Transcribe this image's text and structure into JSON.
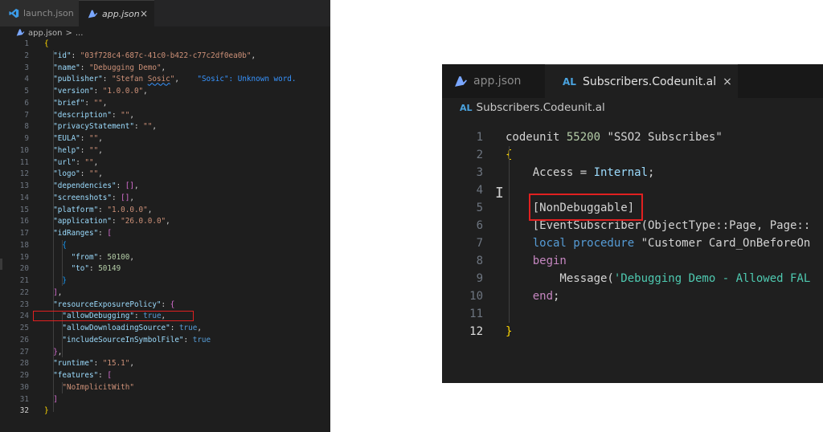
{
  "left_editor": {
    "tabs": [
      {
        "label": "launch.json",
        "icon": "vscode-icon",
        "active": false
      },
      {
        "label": "app.json",
        "icon": "al-file-icon",
        "active": true
      }
    ],
    "close_glyph": "×",
    "breadcrumb": {
      "file": "app.json",
      "separator": ">",
      "rest": "..."
    },
    "line_numbers": [
      "1",
      "2",
      "3",
      "4",
      "5",
      "6",
      "7",
      "8",
      "9",
      "10",
      "11",
      "12",
      "13",
      "14",
      "15",
      "16",
      "17",
      "18",
      "19",
      "20",
      "21",
      "22",
      "23",
      "24",
      "25",
      "26",
      "27",
      "28",
      "29",
      "30",
      "31",
      "32"
    ],
    "active_line": "32",
    "lines": [
      [
        {
          "t": "{",
          "c": "br1"
        }
      ],
      [
        {
          "t": "  \"id\"",
          "c": "key"
        },
        {
          "t": ": ",
          "c": "pun"
        },
        {
          "t": "\"03f728c4-687c-41c0-b422-c77c2df0ea0b\"",
          "c": "str"
        },
        {
          "t": ",",
          "c": "pun"
        }
      ],
      [
        {
          "t": "  \"name\"",
          "c": "key"
        },
        {
          "t": ": ",
          "c": "pun"
        },
        {
          "t": "\"Debugging Demo\"",
          "c": "str"
        },
        {
          "t": ",",
          "c": "pun"
        }
      ],
      [
        {
          "t": "  \"publisher\"",
          "c": "key"
        },
        {
          "t": ": ",
          "c": "pun"
        },
        {
          "t": "\"Stefan ",
          "c": "str"
        },
        {
          "t": "Sosic",
          "c": "str squig"
        },
        {
          "t": "\"",
          "c": "str"
        },
        {
          "t": ",",
          "c": "pun"
        },
        {
          "t": "    \"Sosic\": Unknown word.",
          "c": "warn"
        }
      ],
      [
        {
          "t": "  \"version\"",
          "c": "key"
        },
        {
          "t": ": ",
          "c": "pun"
        },
        {
          "t": "\"1.0.0.0\"",
          "c": "str"
        },
        {
          "t": ",",
          "c": "pun"
        }
      ],
      [
        {
          "t": "  \"brief\"",
          "c": "key"
        },
        {
          "t": ": ",
          "c": "pun"
        },
        {
          "t": "\"\"",
          "c": "str"
        },
        {
          "t": ",",
          "c": "pun"
        }
      ],
      [
        {
          "t": "  \"description\"",
          "c": "key"
        },
        {
          "t": ": ",
          "c": "pun"
        },
        {
          "t": "\"\"",
          "c": "str"
        },
        {
          "t": ",",
          "c": "pun"
        }
      ],
      [
        {
          "t": "  \"privacyStatement\"",
          "c": "key"
        },
        {
          "t": ": ",
          "c": "pun"
        },
        {
          "t": "\"\"",
          "c": "str"
        },
        {
          "t": ",",
          "c": "pun"
        }
      ],
      [
        {
          "t": "  \"EULA\"",
          "c": "key"
        },
        {
          "t": ": ",
          "c": "pun"
        },
        {
          "t": "\"\"",
          "c": "str"
        },
        {
          "t": ",",
          "c": "pun"
        }
      ],
      [
        {
          "t": "  \"help\"",
          "c": "key"
        },
        {
          "t": ": ",
          "c": "pun"
        },
        {
          "t": "\"\"",
          "c": "str"
        },
        {
          "t": ",",
          "c": "pun"
        }
      ],
      [
        {
          "t": "  \"url\"",
          "c": "key"
        },
        {
          "t": ": ",
          "c": "pun"
        },
        {
          "t": "\"\"",
          "c": "str"
        },
        {
          "t": ",",
          "c": "pun"
        }
      ],
      [
        {
          "t": "  \"logo\"",
          "c": "key"
        },
        {
          "t": ": ",
          "c": "pun"
        },
        {
          "t": "\"\"",
          "c": "str"
        },
        {
          "t": ",",
          "c": "pun"
        }
      ],
      [
        {
          "t": "  \"dependencies\"",
          "c": "key"
        },
        {
          "t": ": ",
          "c": "pun"
        },
        {
          "t": "[]",
          "c": "br2"
        },
        {
          "t": ",",
          "c": "pun"
        }
      ],
      [
        {
          "t": "  \"screenshots\"",
          "c": "key"
        },
        {
          "t": ": ",
          "c": "pun"
        },
        {
          "t": "[]",
          "c": "br2"
        },
        {
          "t": ",",
          "c": "pun"
        }
      ],
      [
        {
          "t": "  \"platform\"",
          "c": "key"
        },
        {
          "t": ": ",
          "c": "pun"
        },
        {
          "t": "\"1.0.0.0\"",
          "c": "str"
        },
        {
          "t": ",",
          "c": "pun"
        }
      ],
      [
        {
          "t": "  \"application\"",
          "c": "key"
        },
        {
          "t": ": ",
          "c": "pun"
        },
        {
          "t": "\"26.0.0.0\"",
          "c": "str"
        },
        {
          "t": ",",
          "c": "pun"
        }
      ],
      [
        {
          "t": "  \"idRanges\"",
          "c": "key"
        },
        {
          "t": ": ",
          "c": "pun"
        },
        {
          "t": "[",
          "c": "br2"
        }
      ],
      [
        {
          "t": "    {",
          "c": "br3"
        }
      ],
      [
        {
          "t": "      \"from\"",
          "c": "key"
        },
        {
          "t": ": ",
          "c": "pun"
        },
        {
          "t": "50100",
          "c": "num"
        },
        {
          "t": ",",
          "c": "pun"
        }
      ],
      [
        {
          "t": "      \"to\"",
          "c": "key"
        },
        {
          "t": ": ",
          "c": "pun"
        },
        {
          "t": "50149",
          "c": "num"
        }
      ],
      [
        {
          "t": "    }",
          "c": "br3"
        }
      ],
      [
        {
          "t": "  ]",
          "c": "br2"
        },
        {
          "t": ",",
          "c": "pun"
        }
      ],
      [
        {
          "t": "  \"resourceExposurePolicy\"",
          "c": "key"
        },
        {
          "t": ": ",
          "c": "pun"
        },
        {
          "t": "{",
          "c": "br2"
        }
      ],
      [
        {
          "t": "    \"allowDebugging\"",
          "c": "key"
        },
        {
          "t": ": ",
          "c": "pun"
        },
        {
          "t": "true",
          "c": "bool"
        },
        {
          "t": ",",
          "c": "pun"
        }
      ],
      [
        {
          "t": "    \"allowDownloadingSource\"",
          "c": "key"
        },
        {
          "t": ": ",
          "c": "pun"
        },
        {
          "t": "true",
          "c": "bool"
        },
        {
          "t": ",",
          "c": "pun"
        }
      ],
      [
        {
          "t": "    \"includeSourceInSymbolFile\"",
          "c": "key"
        },
        {
          "t": ": ",
          "c": "pun"
        },
        {
          "t": "true",
          "c": "bool"
        }
      ],
      [
        {
          "t": "  }",
          "c": "br2"
        },
        {
          "t": ",",
          "c": "pun"
        }
      ],
      [
        {
          "t": "  \"runtime\"",
          "c": "key"
        },
        {
          "t": ": ",
          "c": "pun"
        },
        {
          "t": "\"15.1\"",
          "c": "str"
        },
        {
          "t": ",",
          "c": "pun"
        }
      ],
      [
        {
          "t": "  \"features\"",
          "c": "key"
        },
        {
          "t": ": ",
          "c": "pun"
        },
        {
          "t": "[",
          "c": "br2"
        }
      ],
      [
        {
          "t": "    \"NoImplicitWith\"",
          "c": "str"
        }
      ],
      [
        {
          "t": "  ]",
          "c": "br2"
        }
      ],
      [
        {
          "t": "}",
          "c": "br1"
        }
      ]
    ],
    "colors": {
      "background": "#1e1e1e",
      "highlight_box": "#e02020"
    }
  },
  "right_editor": {
    "tabs": [
      {
        "label": "app.json",
        "icon": "al-file-icon",
        "active": false
      },
      {
        "label": "Subscribers.Codeunit.al",
        "icon": "al-badge",
        "badge": "AL",
        "active": true
      }
    ],
    "close_glyph": "×",
    "breadcrumb": {
      "badge": "AL",
      "file": "Subscribers.Codeunit.al"
    },
    "line_numbers": [
      "1",
      "2",
      "3",
      "4",
      "5",
      "6",
      "7",
      "8",
      "9",
      "10",
      "11",
      "12"
    ],
    "active_line": "12",
    "lines": [
      [
        {
          "t": "codeunit ",
          "c": "pun"
        },
        {
          "t": "55200",
          "c": "nm"
        },
        {
          "t": " ",
          "c": "pun"
        },
        {
          "t": "\"SSO2 Subscribes\"",
          "c": "pun"
        }
      ],
      [
        {
          "t": "{",
          "c": "br1"
        }
      ],
      [
        {
          "t": "    Access = ",
          "c": "pun"
        },
        {
          "t": "Internal",
          "c": "ident"
        },
        {
          "t": ";",
          "c": "pun"
        }
      ],
      [
        {
          "t": "",
          "c": "pun"
        }
      ],
      [
        {
          "t": "    [NonDebuggable]",
          "c": "pun"
        }
      ],
      [
        {
          "t": "    [EventSubscriber(ObjectType::Page, Page::",
          "c": "pun"
        }
      ],
      [
        {
          "t": "    ",
          "c": "pun"
        },
        {
          "t": "local procedure",
          "c": "kw"
        },
        {
          "t": " \"Customer Card_OnBeforeOn",
          "c": "pun"
        }
      ],
      [
        {
          "t": "    ",
          "c": "pun"
        },
        {
          "t": "begin",
          "c": "kw2"
        }
      ],
      [
        {
          "t": "        Message(",
          "c": "pun"
        },
        {
          "t": "'Debugging Demo - Allowed FAL",
          "c": "sgl"
        }
      ],
      [
        {
          "t": "    ",
          "c": "pun"
        },
        {
          "t": "end",
          "c": "kw2"
        },
        {
          "t": ";",
          "c": "pun"
        }
      ],
      [
        {
          "t": "",
          "c": "pun"
        }
      ],
      [
        {
          "t": "}",
          "c": "br1"
        }
      ]
    ],
    "colors": {
      "background": "#1f1f1f",
      "highlight_box": "#e02020"
    }
  }
}
